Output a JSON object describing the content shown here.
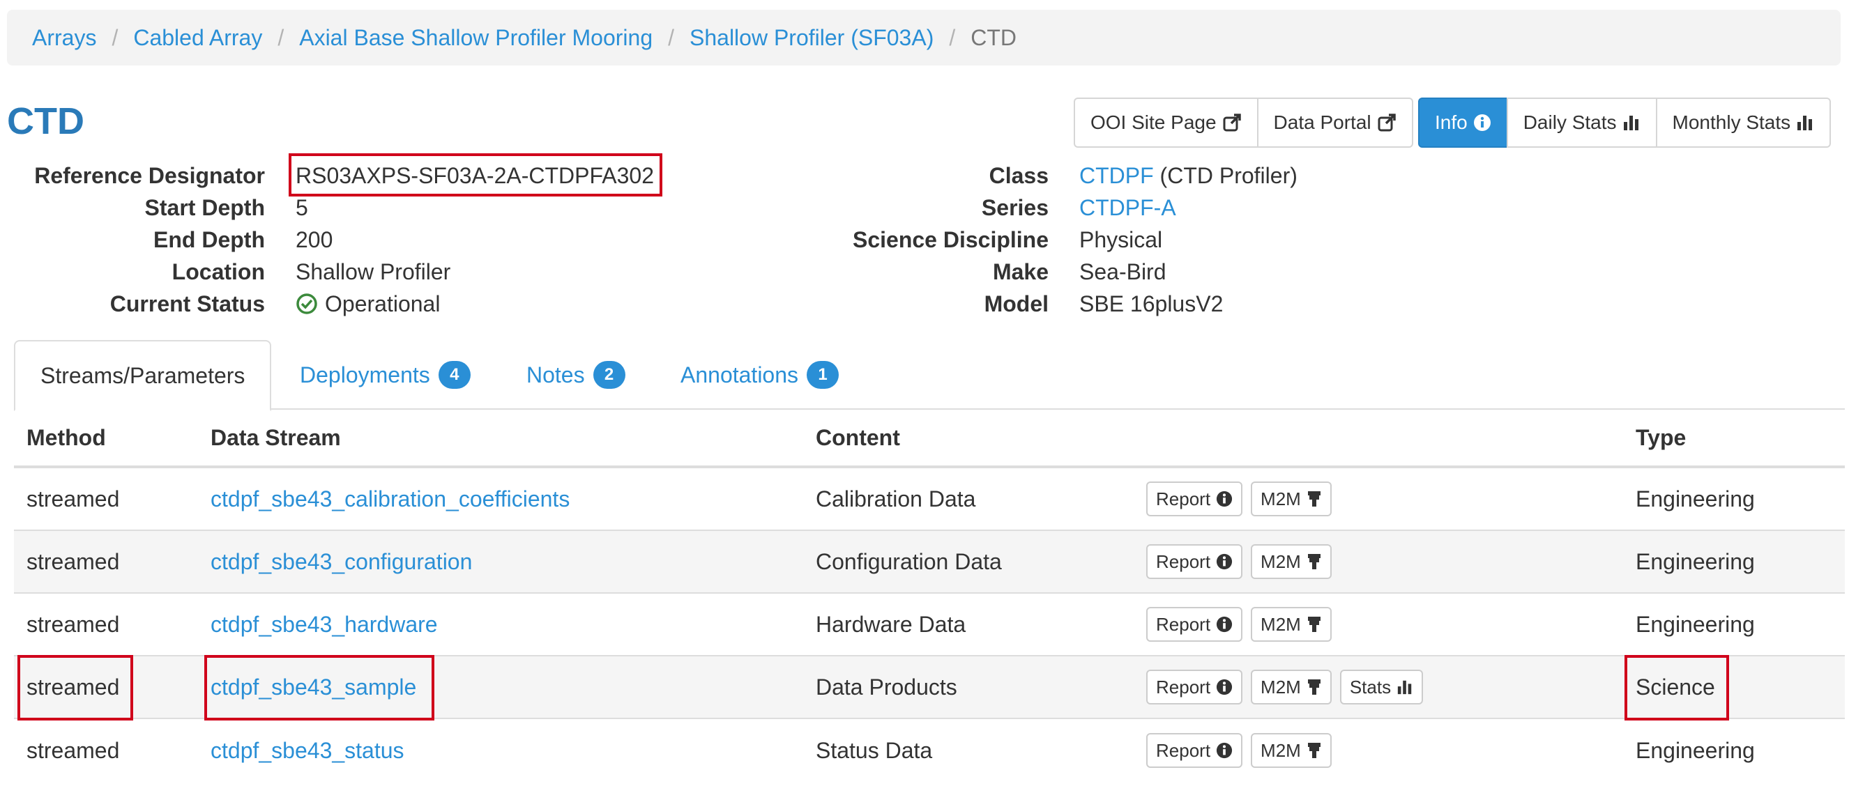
{
  "breadcrumb": {
    "items": [
      "Arrays",
      "Cabled Array",
      "Axial Base Shallow Profiler Mooring",
      "Shallow Profiler (SF03A)"
    ],
    "current": "CTD"
  },
  "page": {
    "title": "CTD"
  },
  "external_buttons": {
    "site_page": "OOI Site Page",
    "data_portal": "Data Portal"
  },
  "view_buttons": {
    "info": "Info",
    "daily_stats": "Daily Stats",
    "monthly_stats": "Monthly Stats"
  },
  "info_left": {
    "reference_designator": {
      "label": "Reference Designator",
      "value": "RS03AXPS-SF03A-2A-CTDPFA302"
    },
    "start_depth": {
      "label": "Start Depth",
      "value": "5"
    },
    "end_depth": {
      "label": "End Depth",
      "value": "200"
    },
    "location": {
      "label": "Location",
      "value": "Shallow Profiler"
    },
    "current_status": {
      "label": "Current Status",
      "value": "Operational"
    }
  },
  "info_right": {
    "class": {
      "label": "Class",
      "link": "CTDPF",
      "suffix": "(CTD Profiler)"
    },
    "series": {
      "label": "Series",
      "link": "CTDPF-A"
    },
    "science_discipline": {
      "label": "Science Discipline",
      "value": "Physical"
    },
    "make": {
      "label": "Make",
      "value": "Sea-Bird"
    },
    "model": {
      "label": "Model",
      "value": "SBE 16plusV2"
    }
  },
  "tabs": {
    "streams": "Streams/Parameters",
    "deployments": {
      "label": "Deployments",
      "count": "4"
    },
    "notes": {
      "label": "Notes",
      "count": "2"
    },
    "annotations": {
      "label": "Annotations",
      "count": "1"
    }
  },
  "table": {
    "headers": {
      "method": "Method",
      "stream": "Data Stream",
      "content": "Content",
      "type": "Type"
    },
    "button_labels": {
      "report": "Report",
      "m2m": "M2M",
      "stats": "Stats"
    },
    "rows": [
      {
        "method": "streamed",
        "stream": "ctdpf_sbe43_calibration_coefficients",
        "content": "Calibration Data",
        "type": "Engineering"
      },
      {
        "method": "streamed",
        "stream": "ctdpf_sbe43_configuration",
        "content": "Configuration Data",
        "type": "Engineering"
      },
      {
        "method": "streamed",
        "stream": "ctdpf_sbe43_hardware",
        "content": "Hardware Data",
        "type": "Engineering"
      },
      {
        "method": "streamed",
        "stream": "ctdpf_sbe43_sample",
        "content": "Data Products",
        "type": "Science"
      },
      {
        "method": "streamed",
        "stream": "ctdpf_sbe43_status",
        "content": "Status Data",
        "type": "Engineering"
      }
    ]
  },
  "colors": {
    "link": "#2a8fd6",
    "title": "#2a7ab8",
    "active_button": "#2a8fd6",
    "highlight": "#d0021b",
    "status_ok": "#3c8a3c"
  }
}
